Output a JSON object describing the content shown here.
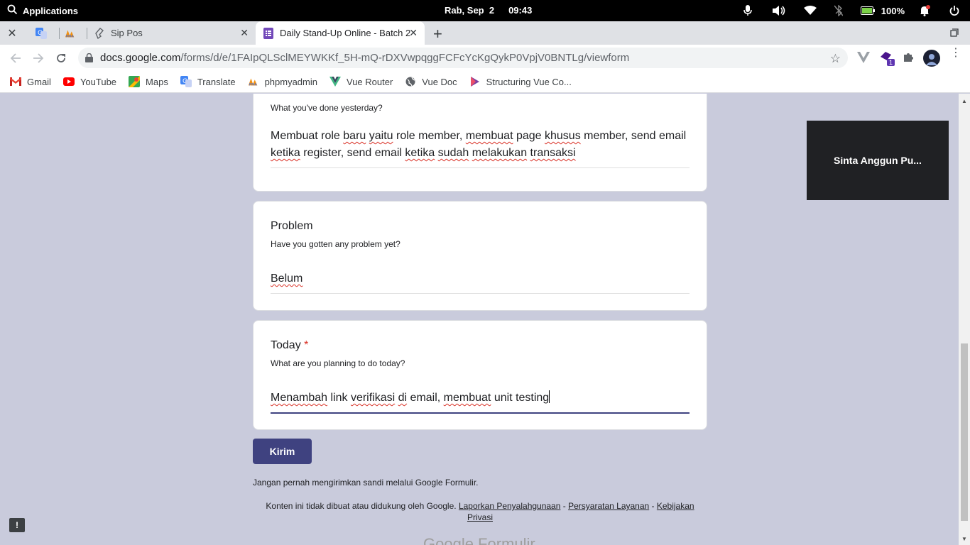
{
  "os_bar": {
    "apps_label": "Applications",
    "date": "Rab, Sep  2",
    "time": "09:43",
    "battery": "100%",
    "tray_icons": [
      "microphone-icon",
      "volume-icon",
      "wifi-icon",
      "bluetooth-off-icon",
      "battery-icon",
      "notifications-icon",
      "power-icon"
    ]
  },
  "tabs": [
    {
      "label": "",
      "icon": "translate-icon"
    },
    {
      "label": "",
      "icon": "phpmyadmin-icon"
    },
    {
      "label": "Sip Pos",
      "icon": "sip-pos-icon"
    },
    {
      "label": "Daily Stand-Up Online - Batch 2",
      "icon": "google-forms-icon",
      "active": true
    }
  ],
  "address_bar": {
    "host": "docs.google.com",
    "path": "/forms/d/e/1FAIpQLSclMEYWKKf_5H-mQ-rDXVwpqggFCFcYcKgQykP0VpjV0BNTLg/viewform"
  },
  "extensions": {
    "badge_count": "1"
  },
  "bookmarks": [
    {
      "label": "Gmail",
      "icon": "gmail-icon"
    },
    {
      "label": "YouTube",
      "icon": "youtube-icon"
    },
    {
      "label": "Maps",
      "icon": "maps-icon"
    },
    {
      "label": "Translate",
      "icon": "translate-icon"
    },
    {
      "label": "phpmyadmin",
      "icon": "phpmyadmin-icon"
    },
    {
      "label": "Vue Router",
      "icon": "vue-icon"
    },
    {
      "label": "Vue Doc",
      "icon": "globe-icon"
    },
    {
      "label": "Structuring Vue Co...",
      "icon": "bookmark-icon"
    }
  ],
  "form": {
    "yesterday": {
      "description": "What you've done yesterday?",
      "answer": "Membuat role baru yaitu role member, membuat page khusus member, send email ketika register, send email ketika sudah melakukan transaksi"
    },
    "problem": {
      "title": "Problem",
      "description": "Have you gotten any problem yet?",
      "answer": "Belum"
    },
    "today": {
      "title": "Today",
      "required_mark": "*",
      "description": "What are you planning to do today?",
      "answer": "Menambah link verifikasi di email, membuat unit testing"
    },
    "submit_label": "Kirim",
    "warning": "Jangan pernah mengirimkan sandi melalui Google Formulir.",
    "footer": {
      "text": "Konten ini tidak dibuat atau didukung oleh Google.",
      "report_link": "Laporkan Penyalahgunaan",
      "dash1": "-",
      "terms_link": "Persyaratan Layanan",
      "dash2": "-",
      "privacy_link_1": "Kebijakan",
      "privacy_link_2": "Privasi"
    },
    "logo_text": "Google Formulir"
  },
  "video_tile": {
    "name": "Sinta Anggun Pu..."
  },
  "feedback_label": "!",
  "colors": {
    "form_theme": "#3f4280",
    "page_bg": "#c9cbdc",
    "required": "#d93025"
  }
}
